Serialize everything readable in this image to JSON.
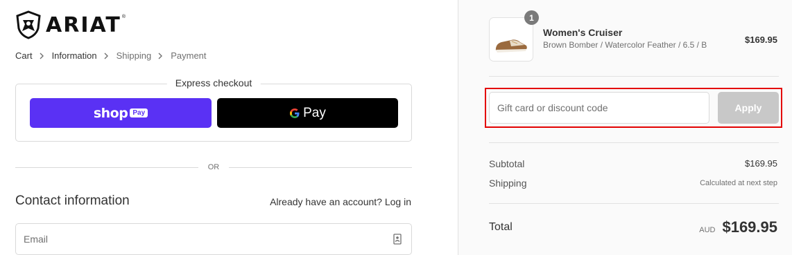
{
  "brand": {
    "name": "ARIAT",
    "tm": "®"
  },
  "breadcrumb": {
    "items": [
      {
        "label": "Cart"
      },
      {
        "label": "Information"
      },
      {
        "label": "Shipping"
      },
      {
        "label": "Payment"
      }
    ]
  },
  "express": {
    "title": "Express checkout",
    "shop_pay": {
      "shop": "shop",
      "pay": "Pay"
    },
    "google_pay": {
      "label": "Pay"
    }
  },
  "divider_text": "OR",
  "contact": {
    "title": "Contact information",
    "account_prompt": "Already have an account?",
    "login_label": "Log in",
    "email_placeholder": "Email"
  },
  "summary": {
    "item": {
      "quantity": "1",
      "name": "Women's Cruiser",
      "variant": "Brown Bomber / Watercolor Feather / 6.5 / B",
      "price": "$169.95"
    },
    "discount": {
      "placeholder": "Gift card or discount code",
      "apply_label": "Apply"
    },
    "subtotal": {
      "label": "Subtotal",
      "value": "$169.95"
    },
    "shipping": {
      "label": "Shipping",
      "value": "Calculated at next step"
    },
    "total": {
      "label": "Total",
      "currency": "AUD",
      "value": "$169.95"
    }
  },
  "colors": {
    "shop_pay": "#5a31f4",
    "google_pay": "#000000",
    "highlight": "#e30000",
    "apply_disabled": "#c8c8c8"
  }
}
